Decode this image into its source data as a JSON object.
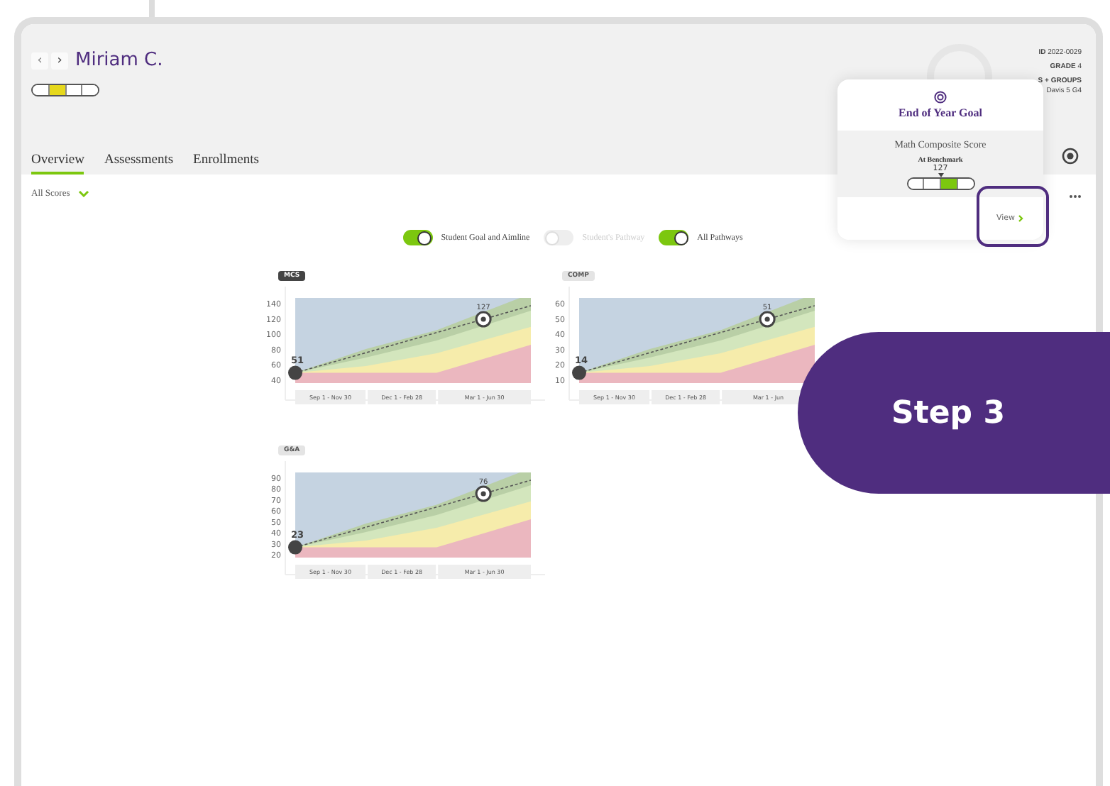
{
  "student": {
    "name": "Miriam C.",
    "nav": [
      {
        "label": "‹",
        "disabled": true
      },
      {
        "label": "›",
        "disabled": false
      }
    ],
    "level_segments": [
      {
        "filled": false
      },
      {
        "filled": true,
        "color": "#e6d81c"
      },
      {
        "filled": false
      },
      {
        "filled": false
      }
    ]
  },
  "info": [
    "**ID** 2022-0029",
    "**GRADE** 4",
    "S + GROUPS",
    "Davis 5 G4"
  ],
  "tabs": [
    {
      "label": "Overview",
      "selected": true
    },
    {
      "label": "Assessments",
      "selected": false
    },
    {
      "label": "Enrollments",
      "selected": false
    }
  ],
  "filter": {
    "label": "All Scores"
  },
  "toggles": [
    {
      "label": "Student Goal and Aimline",
      "on": true
    },
    {
      "label": "Student's Pathway",
      "on": false
    },
    {
      "label": "All Pathways",
      "on": true
    }
  ],
  "goal_popover": {
    "title": "End of Year Goal",
    "measure": "Math Composite Score",
    "status": "At Benchmark",
    "score": "127",
    "segments": [
      {
        "filled": false
      },
      {
        "filled": false
      },
      {
        "filled": true,
        "color": "#7cc70f"
      },
      {
        "filled": false
      }
    ],
    "link": "View",
    "highlighted": true
  },
  "step_badge": "Step 3",
  "charts": [
    {
      "label": "MCS",
      "selected": true,
      "start_score": "51",
      "goal_score": "127",
      "y_axis": [
        "140",
        "120",
        "100",
        "80",
        "60",
        "40"
      ],
      "periods": [
        "Sep 1 - Nov 30",
        "Dec 1 - Feb 28",
        "Mar 1 - Jun 30"
      ]
    },
    {
      "label": "COMP",
      "selected": false,
      "start_score": "14",
      "goal_score": "51",
      "y_axis": [
        "60",
        "50",
        "40",
        "30",
        "20",
        "10"
      ],
      "periods": [
        "Sep 1 - Nov 30",
        "Dec 1 - Feb 28",
        "Mar 1 - Jun"
      ]
    },
    {
      "label": "G&A",
      "selected": false,
      "start_score": "23",
      "goal_score": "76",
      "y_axis": [
        "90",
        "80",
        "70",
        "60",
        "50",
        "40",
        "30",
        "20"
      ],
      "periods": [
        "Sep 1 - Nov 30",
        "Dec 1 - Feb 28",
        "Mar 1 - Jun 30"
      ]
    }
  ]
}
